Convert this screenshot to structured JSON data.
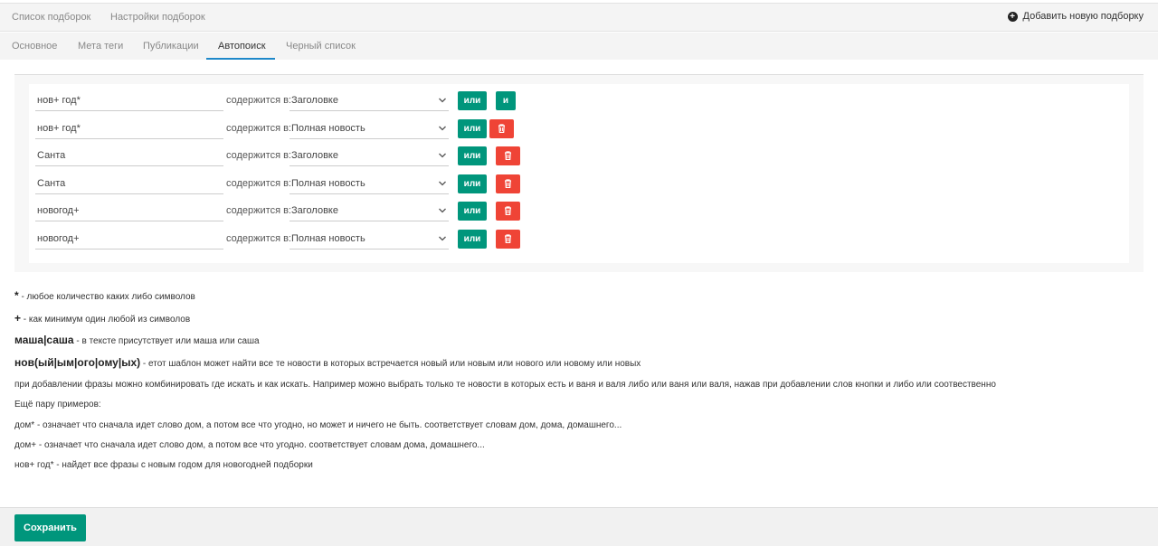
{
  "topbar": {
    "link_list": "Список подборок",
    "link_settings": "Настройки подборок",
    "add_label": "Добавить новую подборку"
  },
  "tabs": [
    {
      "label": "Основное"
    },
    {
      "label": "Мета теги"
    },
    {
      "label": "Публикации"
    },
    {
      "label": "Автопоиск",
      "active": true
    },
    {
      "label": "Черный список"
    }
  ],
  "rules": {
    "contains_label": "содержится в:",
    "or_label": "или",
    "and_label": "и",
    "rows": [
      {
        "word": "нов+ год*",
        "where": "Заголовке"
      },
      {
        "word": "нов+ год*",
        "where": "Полная новость"
      },
      {
        "word": "Санта",
        "where": "Заголовке"
      },
      {
        "word": "Санта",
        "where": "Полная новость"
      },
      {
        "word": "новогод+",
        "where": "Заголовке"
      },
      {
        "word": "новогод+",
        "where": "Полная новость"
      }
    ]
  },
  "help": {
    "star_sym": "*",
    "star_text": " - любое количество каких либо символов",
    "plus_sym": "+",
    "plus_text": " - как минимум один любой из символов",
    "or_sym": "маша|саша",
    "or_text": " - в тексте присутствует или маша или саша",
    "group_sym": "нов(ый|ым|ого|ому|ых)",
    "group_text": " - етот шаблон может найти все те новости в которых встречается новый или новым или нового или новому или новых",
    "combine": "при добавлении фразы можно комбинировать где искать и как искать. Например можно выбрать только те новости в которых есть и ваня и валя либо или ваня или валя, нажав при добавлении слов кнопки и либо или соотвественно",
    "examples_title": "Ещё пару примеров:",
    "ex1": "дом* - означает что сначала идет слово дом, а потом все что угодно, но может и ничего не быть. соответствует словам дом, дома, домашнего...",
    "ex2": "дом+ - означает что сначала идет слово дом, а потом все что угодно. соответствует словам дома, домашнего...",
    "ex3": "нов+ год* - найдет все фразы с новым годом для новогодней подборки"
  },
  "footer": {
    "save_label": "Сохранить"
  },
  "colors": {
    "accent": "#00967c",
    "danger": "#ef4436",
    "tab_underline": "#1e88c9"
  }
}
